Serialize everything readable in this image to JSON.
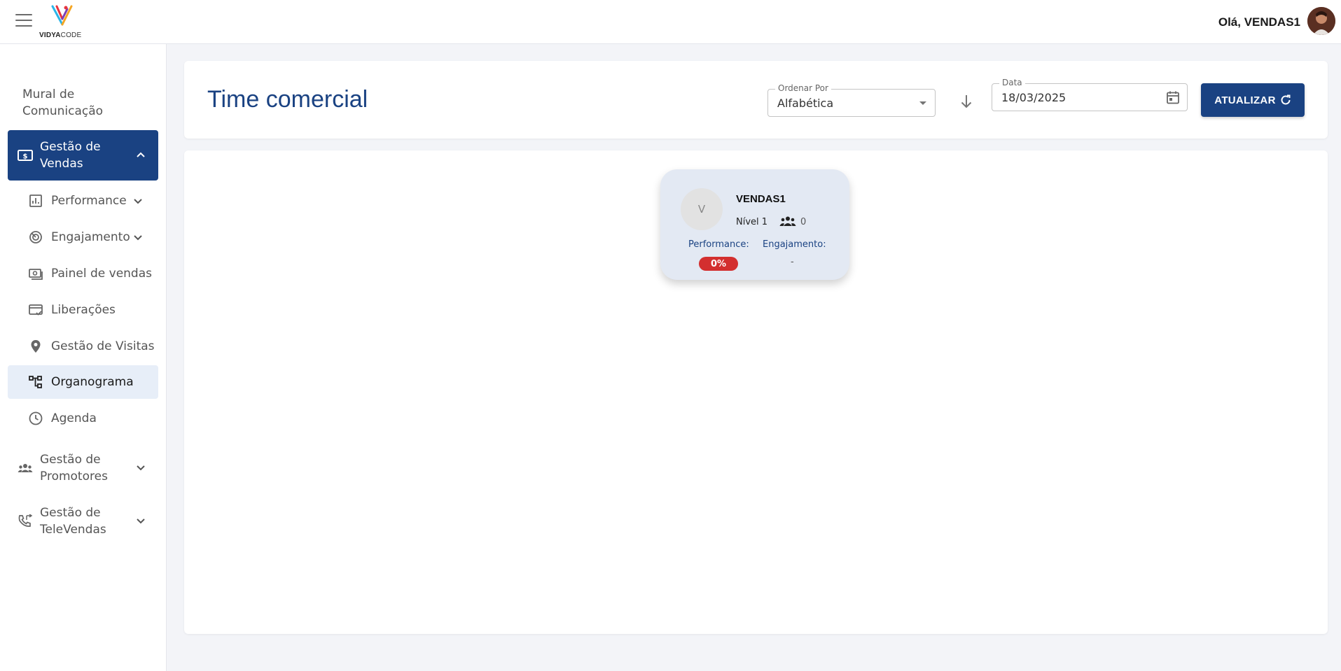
{
  "topbar": {
    "logo_brand_bold": "VIDYA",
    "logo_brand_light": "CODE",
    "greeting": "Olá, VENDAS1"
  },
  "sidebar": {
    "mural": "Mural de Comunicação",
    "group_vendas": "Gestão de Vendas",
    "items": [
      {
        "label": "Performance"
      },
      {
        "label": "Engajamento"
      },
      {
        "label": "Painel de vendas"
      },
      {
        "label": "Liberações"
      },
      {
        "label": "Gestão de Visitas"
      },
      {
        "label": "Organograma"
      },
      {
        "label": "Agenda"
      }
    ],
    "group_promotores": "Gestão de Promotores",
    "group_televendas": "Gestão de TeleVendas"
  },
  "header": {
    "title": "Time comercial",
    "sort_label": "Ordenar Por",
    "sort_value": "Alfabética",
    "date_label": "Data",
    "date_value": "18/03/2025",
    "refresh_label": "ATUALIZAR"
  },
  "org": {
    "avatar_initial": "V",
    "name": "VENDAS1",
    "level": "Nível 1",
    "team_count": "0",
    "performance_label": "Performance:",
    "performance_value": "0%",
    "engagement_label": "Engajamento:",
    "engagement_value": "-"
  },
  "colors": {
    "primary": "#1a4282",
    "danger": "#d32f2f",
    "selected_bg": "#e7eef8"
  }
}
